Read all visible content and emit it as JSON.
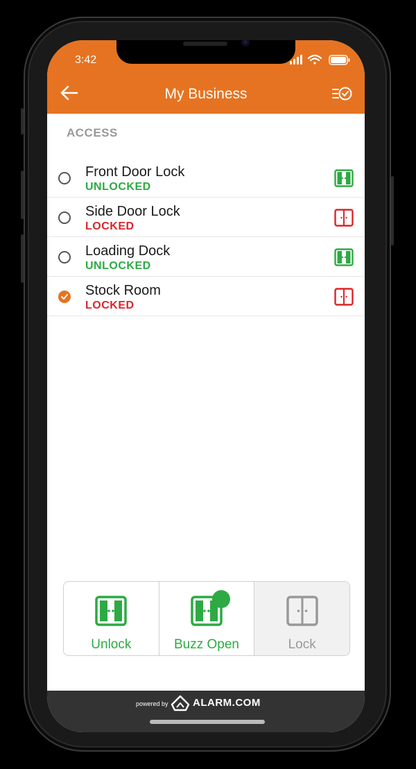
{
  "status_bar": {
    "time": "3:42"
  },
  "header": {
    "title": "My Business"
  },
  "section": {
    "label": "ACCESS"
  },
  "locks": [
    {
      "name": "Front Door Lock",
      "state": "UNLOCKED",
      "selected": false
    },
    {
      "name": "Side Door Lock",
      "state": "LOCKED",
      "selected": false
    },
    {
      "name": "Loading Dock",
      "state": "UNLOCKED",
      "selected": false
    },
    {
      "name": "Stock Room",
      "state": "LOCKED",
      "selected": true
    }
  ],
  "actions": {
    "unlock": "Unlock",
    "buzz_open": "Buzz Open",
    "lock": "Lock"
  },
  "footer": {
    "powered_by": "powered by",
    "brand": "ALARM.COM"
  },
  "colors": {
    "accent": "#E67321",
    "unlocked": "#2DAA43",
    "locked": "#D9262B"
  },
  "icons": {
    "back": "arrow-left-icon",
    "task": "task-list-check-icon",
    "door": "door-icon"
  }
}
